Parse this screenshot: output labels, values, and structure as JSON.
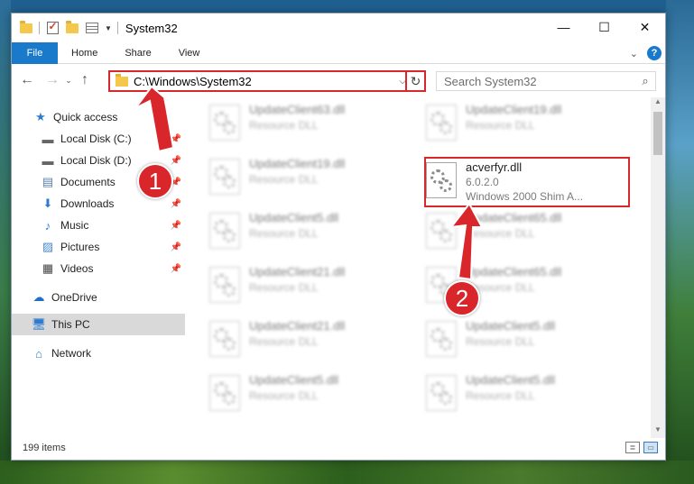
{
  "window": {
    "title": "System32",
    "controls": {
      "minimize": "—",
      "maximize": "☐",
      "close": "✕"
    }
  },
  "ribbon": {
    "tabs": [
      {
        "label": "File"
      },
      {
        "label": "Home"
      },
      {
        "label": "Share"
      },
      {
        "label": "View"
      }
    ],
    "help_label": "?"
  },
  "nav": {
    "back": "←",
    "forward": "→",
    "recent": "⌄",
    "up": "↑"
  },
  "address": {
    "path": "C:\\Windows\\System32",
    "refresh": "↻"
  },
  "search": {
    "placeholder": "Search System32",
    "icon": "search-icon"
  },
  "sidebar": {
    "items": [
      {
        "label": "Quick access",
        "icon": "star-icon",
        "pinned": false
      },
      {
        "label": "Local Disk (C:)",
        "icon": "drive-icon",
        "pinned": true
      },
      {
        "label": "Local Disk (D:)",
        "icon": "drive-icon",
        "pinned": true
      },
      {
        "label": "Documents",
        "icon": "documents-icon",
        "pinned": true
      },
      {
        "label": "Downloads",
        "icon": "download-icon",
        "pinned": true
      },
      {
        "label": "Music",
        "icon": "music-icon",
        "pinned": true
      },
      {
        "label": "Pictures",
        "icon": "pictures-icon",
        "pinned": true
      },
      {
        "label": "Videos",
        "icon": "videos-icon",
        "pinned": true
      },
      {
        "label": "OneDrive",
        "icon": "cloud-icon",
        "pinned": false
      },
      {
        "label": "This PC",
        "icon": "computer-icon",
        "pinned": false,
        "selected": true
      },
      {
        "label": "Network",
        "icon": "network-icon",
        "pinned": false
      }
    ]
  },
  "files": {
    "left_column": [
      {
        "name": "UpdateClient63.dll",
        "desc": "Resource DLL"
      },
      {
        "name": "UpdateClient19.dll",
        "desc": "Resource DLL"
      },
      {
        "name": "UpdateClient5.dll",
        "desc": "Resource DLL"
      },
      {
        "name": "UpdateClient21.dll",
        "desc": "Resource DLL"
      },
      {
        "name": "UpdateClient21.dll",
        "desc": "Resource DLL"
      },
      {
        "name": "UpdateClient5.dll",
        "desc": "Resource DLL"
      }
    ],
    "right_column": [
      {
        "name": "UpdateClient19.dll",
        "desc": "Resource DLL"
      },
      {
        "name": "acverfyr.dll",
        "version": "6.0.2.0",
        "desc": "Windows 2000 Shim A..."
      },
      {
        "name": "UpdateClient65.dll",
        "desc": "Resource DLL"
      },
      {
        "name": "UpdateClient65.dll",
        "desc": "Resource DLL"
      },
      {
        "name": "UpdateClient5.dll",
        "desc": "Resource DLL"
      },
      {
        "name": "UpdateClient5.dll",
        "desc": "Resource DLL"
      }
    ]
  },
  "status": {
    "item_count": "199 items"
  },
  "annotations": {
    "step1": "1",
    "step2": "2",
    "accent": "#d9262b"
  }
}
